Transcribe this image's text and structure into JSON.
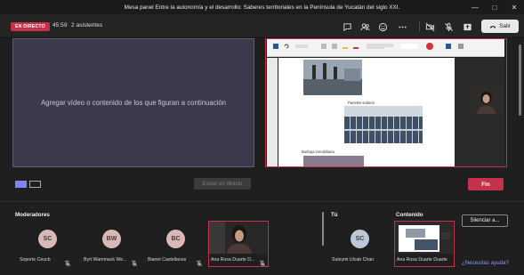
{
  "window": {
    "title": "Mesa panel Entre la autonomía y el desarrollo: Saberes territoriales en la Península de Yucatán del siglo XXI."
  },
  "toolbar": {
    "live_badge": "EN DIRECTO",
    "timer": "45:59",
    "attendees": "2 asistentes",
    "leave_label": "Salir",
    "icons": [
      "chat-icon",
      "participants-icon",
      "reactions-icon",
      "more-icon",
      "camera-off-icon",
      "mic-off-icon",
      "share-icon",
      "phone-icon"
    ]
  },
  "stage": {
    "empty_prompt": "Agregar vídeo o contenido de los que figuran a continuación",
    "doc_captions": [
      "Paneles solares",
      "Burbuja inmobiliaria"
    ]
  },
  "controls": {
    "start_label": "Enviar en directo",
    "end_label": "Fin"
  },
  "roster": {
    "moderators_label": "Moderadores",
    "you_label": "Tú",
    "content_label": "Contenido",
    "silence_label": "Silenciar a...",
    "help_label": "¿Necesitas ayuda?",
    "moderators": [
      {
        "initials": "SC",
        "name": "Soporte Ceucb",
        "avatar_color": "#d9b8b6"
      },
      {
        "initials": "BW",
        "name": "Byrt Wammack We...",
        "avatar_color": "#d9b8b6"
      },
      {
        "initials": "BC",
        "name": "Bianet Castellanos",
        "avatar_color": "#d9b8b6"
      },
      {
        "initials": "",
        "name": "Ana Rosa Duarte D...",
        "avatar_color": ""
      }
    ],
    "you": {
      "initials": "SC",
      "name": "Suleymi Ulcab Chan",
      "avatar_color": "#bcc8d8"
    },
    "content": {
      "name": "Ana Rosa Duarte Duarte"
    }
  },
  "colors": {
    "accent_red": "#c4314b",
    "accent_purple": "#7f85f5",
    "link": "#8f95ff"
  }
}
